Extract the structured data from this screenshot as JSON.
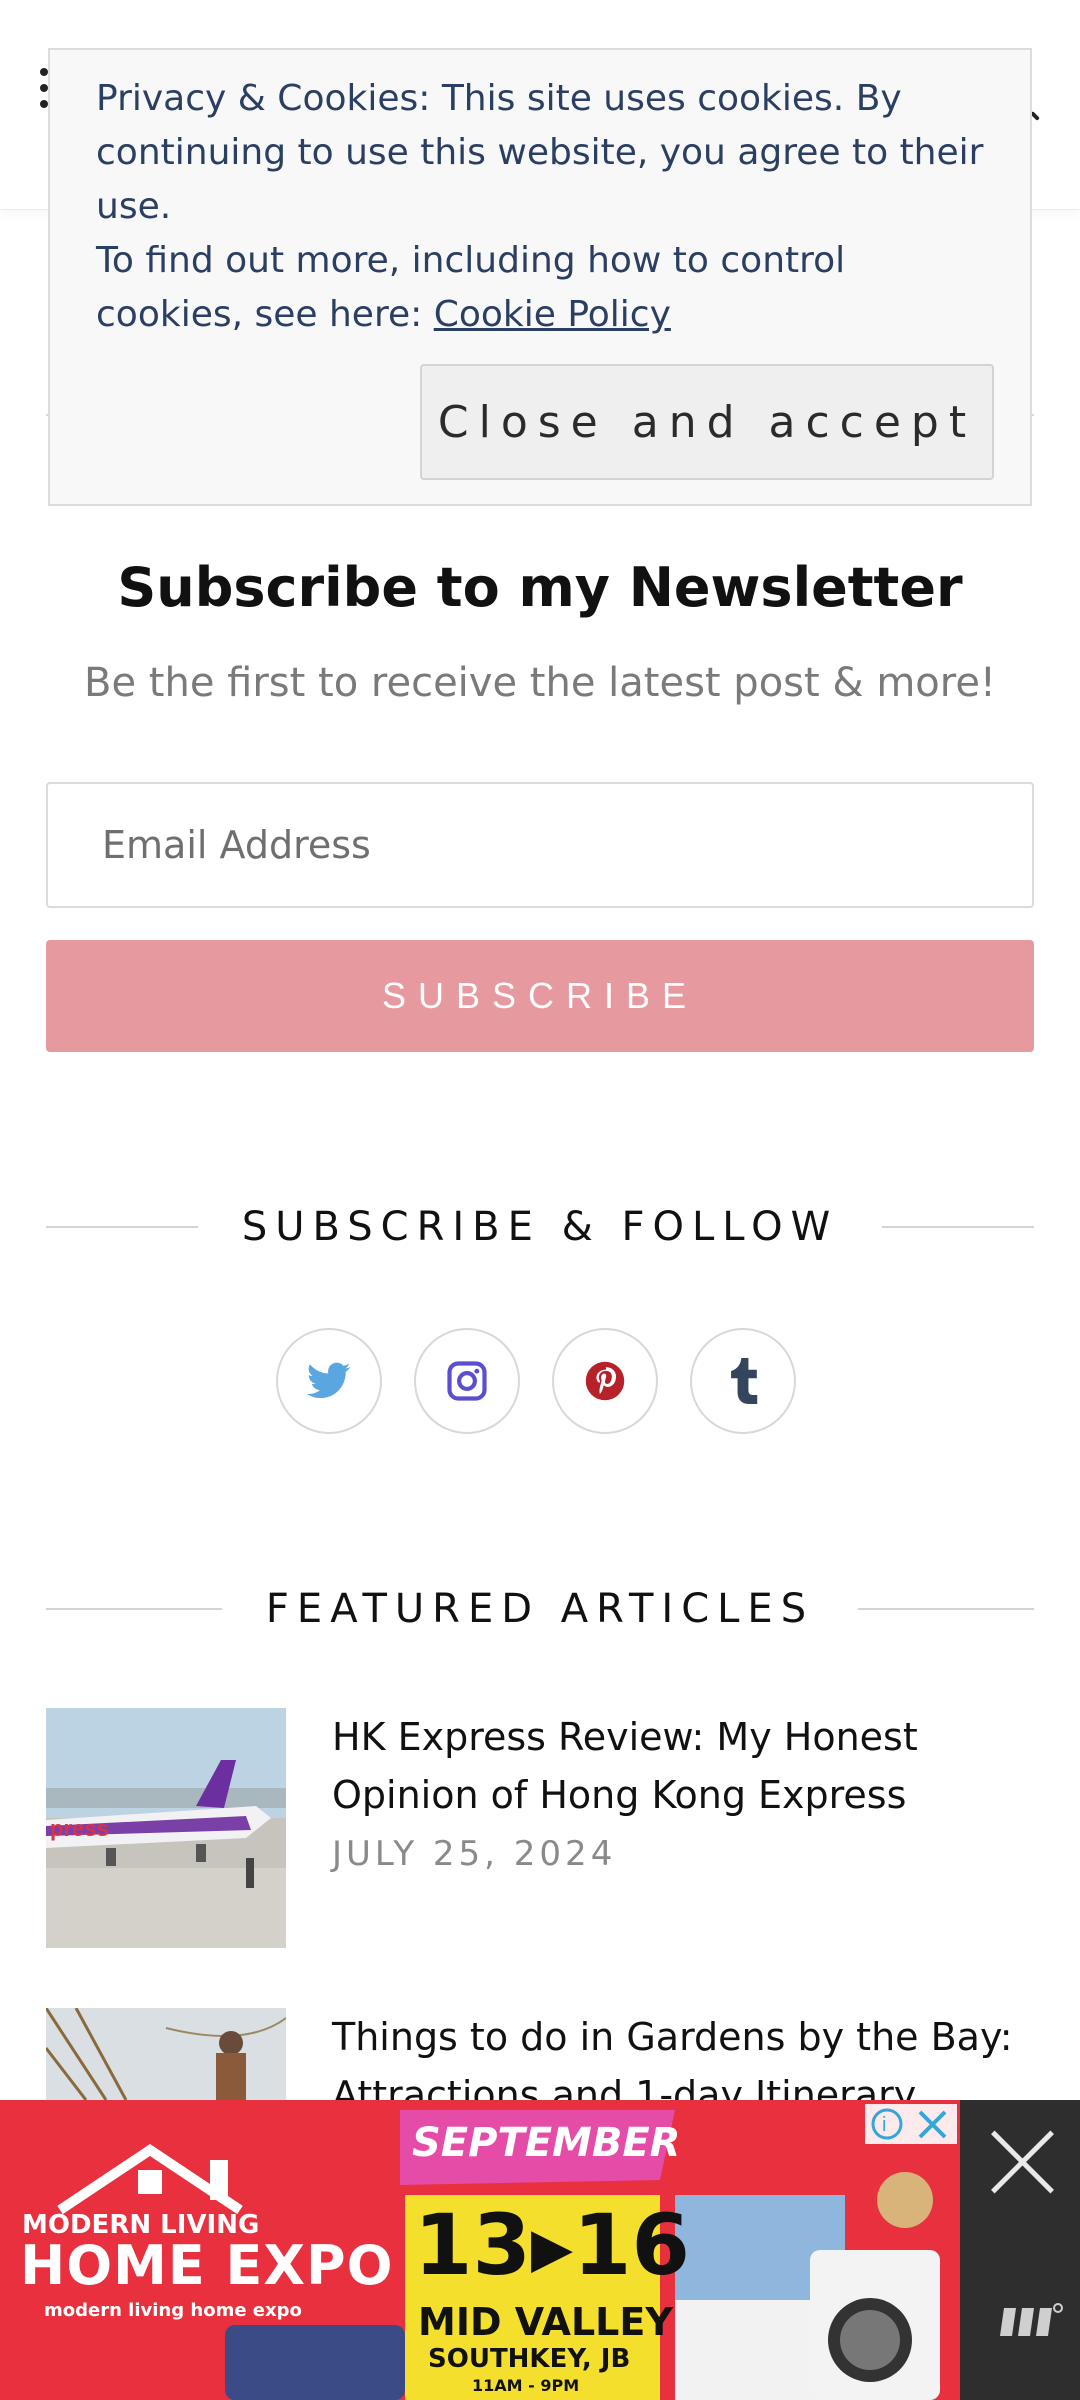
{
  "header": {
    "menu_icon": "menu-dots-icon",
    "search_icon": "search-icon"
  },
  "cookie_banner": {
    "text_line1": "Privacy & Cookies: This site uses cookies. By continuing to use this website, you agree to their use.",
    "text_line2_prefix": "To find out more, including how to control cookies, see here: ",
    "link_label": "Cookie Policy",
    "accept_label": "Close and accept"
  },
  "newsletter": {
    "title": "Subscribe to my Newsletter",
    "subtitle": "Be the first to receive the latest post & more!",
    "email_placeholder": "Email Address",
    "button_label": "SUBSCRIBE"
  },
  "follow": {
    "heading": "SUBSCRIBE & FOLLOW",
    "icons": [
      "twitter-icon",
      "instagram-icon",
      "pinterest-icon",
      "tumblr-icon"
    ],
    "colors": {
      "twitter": "#5aa6e0",
      "instagram": "#5a4fcf",
      "pinterest": "#b7212a",
      "tumblr": "#34465d"
    }
  },
  "featured": {
    "heading": "FEATURED ARTICLES",
    "articles": [
      {
        "title": "HK Express Review: My Honest Opinion of Hong Kong Express",
        "date": "JULY 25, 2024"
      },
      {
        "title": "Things to do in Gardens by the Bay: Attractions and 1-day Itinerary",
        "date": ""
      }
    ]
  },
  "ad": {
    "brand": "MODERN LIVING",
    "brand_big": "HOME EXPO",
    "brand_small": "modern living home expo",
    "month": "SEPTEMBER",
    "dates": "13▸16",
    "venue": "MID VALLEY",
    "venue_sub": "SOUTHKEY, JB",
    "hours": "11AM - 9PM",
    "colors": {
      "bg": "#e8303e",
      "accent_pink": "#e44ca8",
      "accent_yellow": "#f4e02c"
    }
  }
}
